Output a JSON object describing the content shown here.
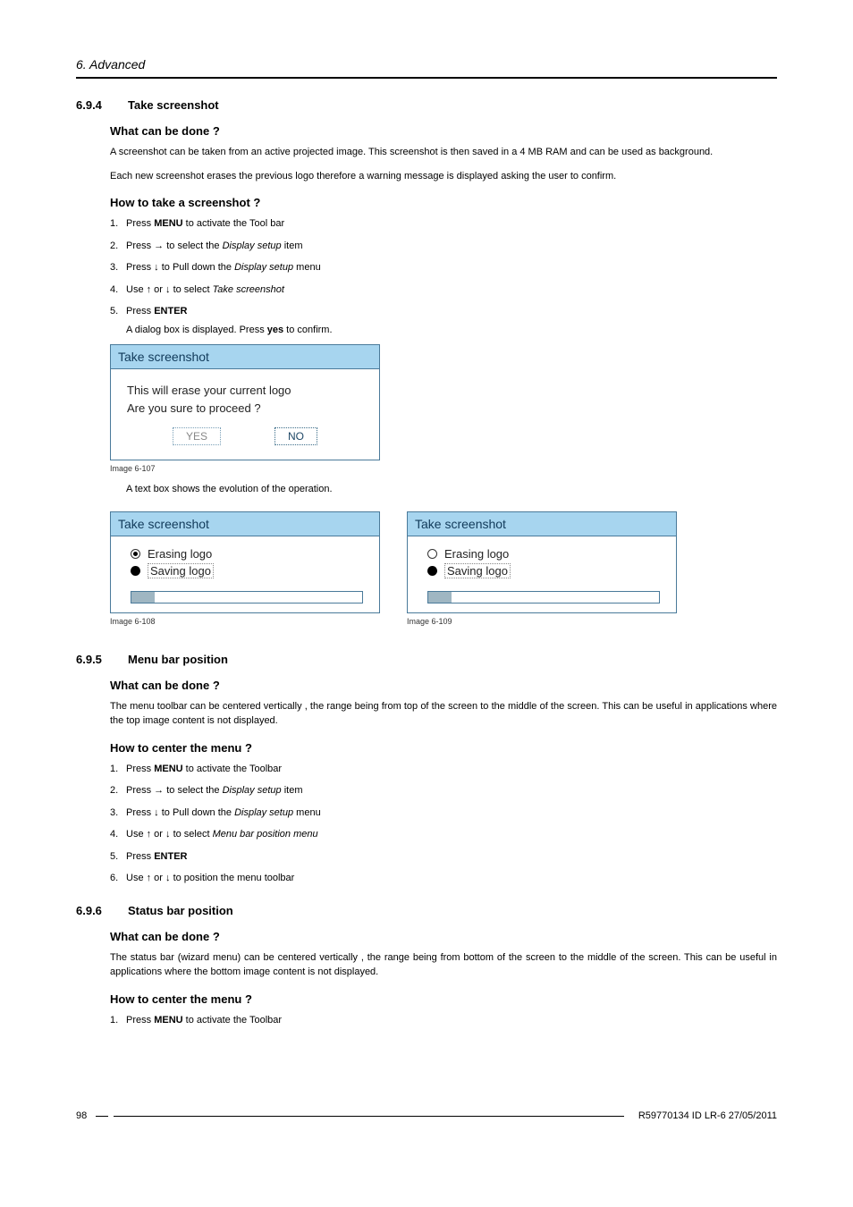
{
  "header": {
    "chapter": "6.  Advanced"
  },
  "s694": {
    "num": "6.9.4",
    "title": "Take screenshot",
    "wcbd_h": "What can be done ?",
    "wcbd_p1": "A screenshot can be taken from an active projected image.  This screenshot is then saved in a 4 MB RAM and can be used as background.",
    "wcbd_p2": "Each new screenshot erases the previous logo therefore a warning message is displayed asking the user to confirm.",
    "howto_h": "How to take a screenshot ?",
    "steps": {
      "s1_a": "Press ",
      "s1_b": "MENU",
      "s1_c": " to activate the Tool bar",
      "s2_a": "Press → to select the ",
      "s2_b": "Display setup",
      "s2_c": " item",
      "s3_a": "Press ↓ to Pull down the ",
      "s3_b": "Display setup",
      "s3_c": " menu",
      "s4_a": "Use ↑ or ↓ to select ",
      "s4_b": "Take screenshot",
      "s5_a": "Press ",
      "s5_b": "ENTER",
      "s5_sub_a": "A dialog box is displayed.  Press ",
      "s5_sub_b": "yes",
      "s5_sub_c": " to confirm."
    },
    "dialog1": {
      "title": "Take screenshot",
      "line1": "This will erase your current logo",
      "line2": "Are you sure to proceed ?",
      "yes": "YES",
      "no": "NO",
      "caption": "Image 6-107"
    },
    "after_dialog": "A text box shows the evolution of the operation.",
    "dialog2": {
      "title": "Take screenshot",
      "opt1": "Erasing logo",
      "opt2": "Saving logo",
      "caption": "Image 6-108"
    },
    "dialog3": {
      "title": "Take screenshot",
      "opt1": "Erasing logo",
      "opt2": "Saving logo",
      "caption": "Image 6-109"
    }
  },
  "s695": {
    "num": "6.9.5",
    "title": "Menu bar position",
    "wcbd_h": "What can be done ?",
    "wcbd_p": "The menu toolbar can be centered vertically , the range being from top of the screen to the middle of the screen.  This can be useful in applications where the top image content is not displayed.",
    "howto_h": "How to center the menu ?",
    "steps": {
      "s1_a": "Press ",
      "s1_b": "MENU",
      "s1_c": " to activate the Toolbar",
      "s2_a": "Press → to select the ",
      "s2_b": "Display setup",
      "s2_c": " item",
      "s3_a": "Press ↓ to Pull down the ",
      "s3_b": "Display setup",
      "s3_c": " menu",
      "s4_a": "Use ↑ or ↓ to select ",
      "s4_b": "Menu bar position menu",
      "s5_a": "Press ",
      "s5_b": "ENTER",
      "s6": "Use ↑ or ↓ to position the menu toolbar"
    }
  },
  "s696": {
    "num": "6.9.6",
    "title": "Status bar position",
    "wcbd_h": "What can be done ?",
    "wcbd_p": "The status bar (wizard menu) can be centered vertically , the range being from bottom of the screen to the middle of the screen. This can be useful in applications where the bottom image content is not displayed.",
    "howto_h": "How to center the menu ?",
    "steps": {
      "s1_a": "Press ",
      "s1_b": "MENU",
      "s1_c": " to activate the Toolbar"
    }
  },
  "footer": {
    "page": "98",
    "docid": "R59770134  ID LR-6  27/05/2011"
  }
}
